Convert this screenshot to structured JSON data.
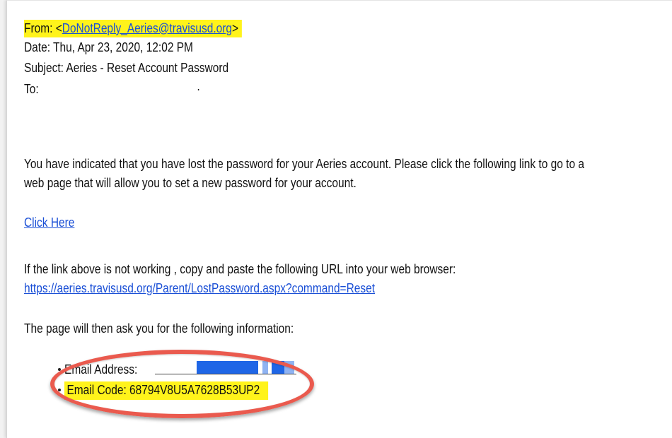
{
  "email": {
    "from_label": "From: <",
    "from_address": "DoNotReply_Aeries@travisusd.org",
    "from_close": ">",
    "date": "Date: Thu, Apr 23, 2020, 12:02 PM",
    "subject": "Subject: Aeries - Reset Account Password",
    "to_label": "To:",
    "to_value": "·",
    "body_line1": "You have indicated that you have lost the password for your Aeries account. Please click the following link to go to a",
    "body_line2": "web page that will allow you to set a new password for your account.",
    "click_here": "Click Here",
    "fallback_text": "If the link above is not working , copy and paste the following URL into your web browser:",
    "fallback_url": "https://aeries.travisusd.org/Parent/LostPassword.aspx?command=Reset",
    "info_intro": "The page will then ask you for the following information:",
    "info_items": [
      {
        "text": "Email Address:"
      },
      {
        "text": "Email Code: 68794V8U5A7628B53UP2"
      }
    ]
  },
  "colors": {
    "highlight": "#fff31b",
    "link": "#1a4fd6",
    "annotation_circle": "#ea5a4e",
    "redaction": "#1f66e6"
  }
}
